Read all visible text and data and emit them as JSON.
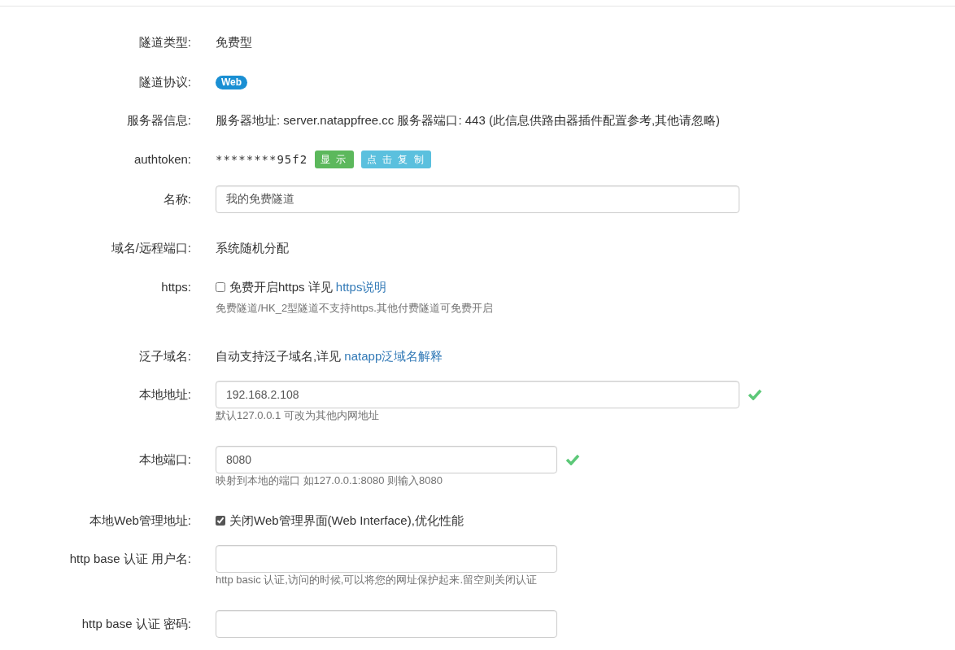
{
  "rows": [
    {
      "kind": "text",
      "label": "隧道类型:",
      "value": "免费型"
    },
    {
      "kind": "badge",
      "label": "隧道协议:",
      "badge": "Web"
    },
    {
      "kind": "text",
      "label": "服务器信息:",
      "value": "服务器地址: server.natappfree.cc 服务器端口: 443 (此信息供路由器插件配置参考,其他请忽略)"
    },
    {
      "kind": "token",
      "label": "authtoken:",
      "value": "********95f2",
      "buttons": [
        {
          "label": "显 示",
          "color": "#5cb85c"
        },
        {
          "label": "点 击 复 制",
          "color": "#5bc0de"
        }
      ]
    },
    {
      "kind": "wide_input",
      "label": "名称:",
      "value": "我的免费隧道",
      "valid": false
    },
    {
      "kind": "text",
      "label": "域名/远程端口:",
      "value": "系统随机分配"
    },
    {
      "kind": "checkbox",
      "label": "https:",
      "text": "免费开启https 详见 ",
      "link": "https说明",
      "checked": false,
      "hint": "免费隧道/HK_2型隧道不支持https.其他付费隧道可免费开启"
    },
    {
      "kind": "text",
      "label": "泛子域名:",
      "value": "自动支持泛子域名,详见 ",
      "link": "natapp泛域名解释"
    },
    {
      "kind": "wide_input",
      "label": "本地地址:",
      "value": "192.168.2.108",
      "valid": true,
      "hint": "默认127.0.0.1 可改为其他内网地址"
    },
    {
      "kind": "input",
      "label": "本地端口:",
      "value": "8080",
      "valid": true,
      "hint": "映射到本地的端口 如127.0.0.1:8080 则输入8080"
    },
    {
      "kind": "checkbox",
      "label": "本地Web管理地址:",
      "text": "关闭Web管理界面(Web Interface),优化性能",
      "checked": true
    },
    {
      "kind": "input",
      "label": "http base 认证 用户名:",
      "value": "",
      "valid": false,
      "hint": "http basic 认证,访问的时候,可以将您的网址保护起来.留空则关闭认证"
    },
    {
      "kind": "input",
      "label": "http base 认证 密码:",
      "value": "",
      "valid": false
    }
  ]
}
